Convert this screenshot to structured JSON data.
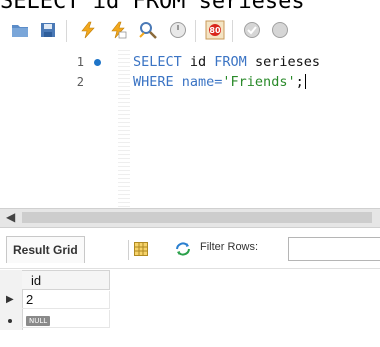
{
  "top_clip_text": "SELECT id FROM serieses",
  "toolbar": {
    "icons": [
      "open-folder-icon",
      "save-icon",
      "execute-icon",
      "execute-current-icon",
      "explain-icon",
      "stop-icon",
      "toggle-error-icon",
      "commit-icon",
      "rollback-icon"
    ]
  },
  "editor": {
    "lines": [
      {
        "number": "1",
        "kw1": "SELECT",
        "t1": " id ",
        "kw2": "FROM",
        "t2": " serieses"
      },
      {
        "number": "2",
        "kw1": "WHERE",
        "t1": " name=",
        "str": "'Friends'",
        "t2": ";"
      }
    ]
  },
  "results": {
    "tab_label": "Result Grid",
    "filter_label": "Filter Rows:",
    "filter_value": "",
    "column_header": "id",
    "rows": [
      "2"
    ],
    "null_label": "NULL"
  },
  "colors": {
    "keyword": "#3b74c4",
    "string": "#2a8a2a",
    "bookmark_dot": "#1e74c8"
  }
}
